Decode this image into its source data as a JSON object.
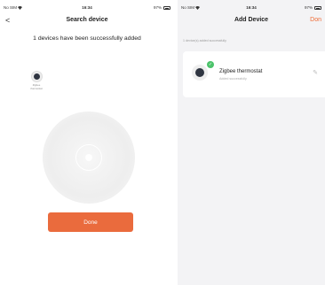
{
  "left_screen": {
    "status_bar": {
      "carrier": "No SIM",
      "time": "16:34",
      "battery": "97%"
    },
    "nav": {
      "back_symbol": "<",
      "title": "Search device"
    },
    "headline": "1 devices have been successfully added",
    "mini_device": {
      "label_line1": "Zigbee",
      "label_line2": "thermostat"
    },
    "done_label": "Done"
  },
  "right_screen": {
    "status_bar": {
      "carrier": "No SIM",
      "time": "16:34",
      "battery": "97%"
    },
    "nav": {
      "title": "Add Device",
      "action": "Don"
    },
    "note": "1 device(s) added successfully",
    "device": {
      "name": "Zigbee thermostat",
      "status": "Added successfully",
      "check_symbol": "✓",
      "edit_symbol": "✎"
    }
  },
  "colors": {
    "accent": "#ea6b3d",
    "success": "#4cc36b"
  }
}
